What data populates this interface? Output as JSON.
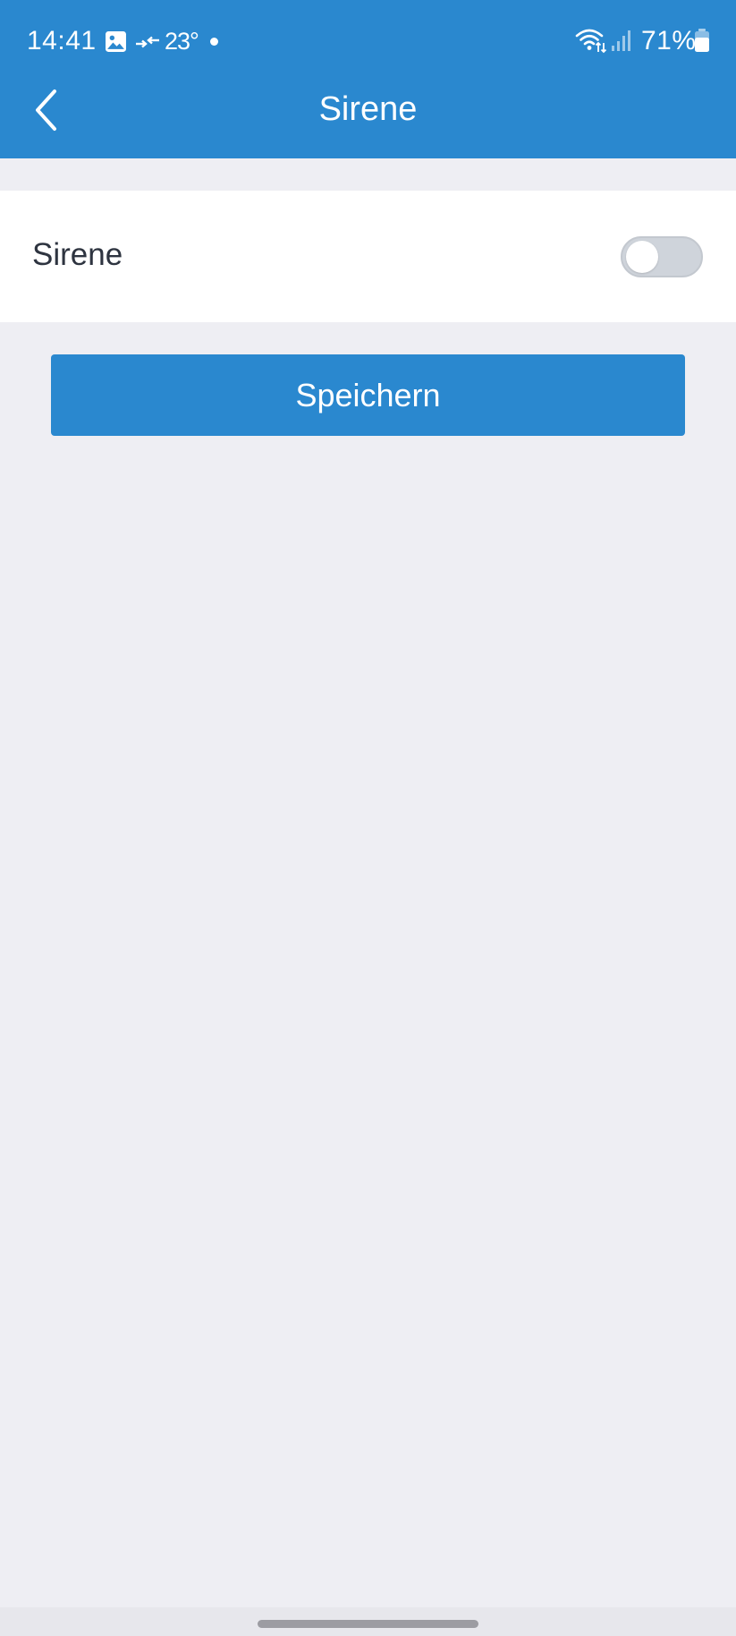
{
  "status_bar": {
    "time": "14:41",
    "temperature": "23°",
    "battery": "71%",
    "icons": [
      "gallery-icon",
      "arrows-icon",
      "notification-dot",
      "wifi-icon",
      "signal-icon",
      "battery-icon"
    ]
  },
  "header": {
    "title": "Sirene",
    "back_icon": "chevron-left-icon"
  },
  "setting": {
    "label": "Sirene",
    "toggle_on": false
  },
  "actions": {
    "save_label": "Speichern"
  },
  "colors": {
    "primary": "#2a88cf",
    "background": "#eeeef3",
    "card": "#ffffff",
    "toggle_off": "#cfd4db",
    "label_text": "#2e3440"
  }
}
